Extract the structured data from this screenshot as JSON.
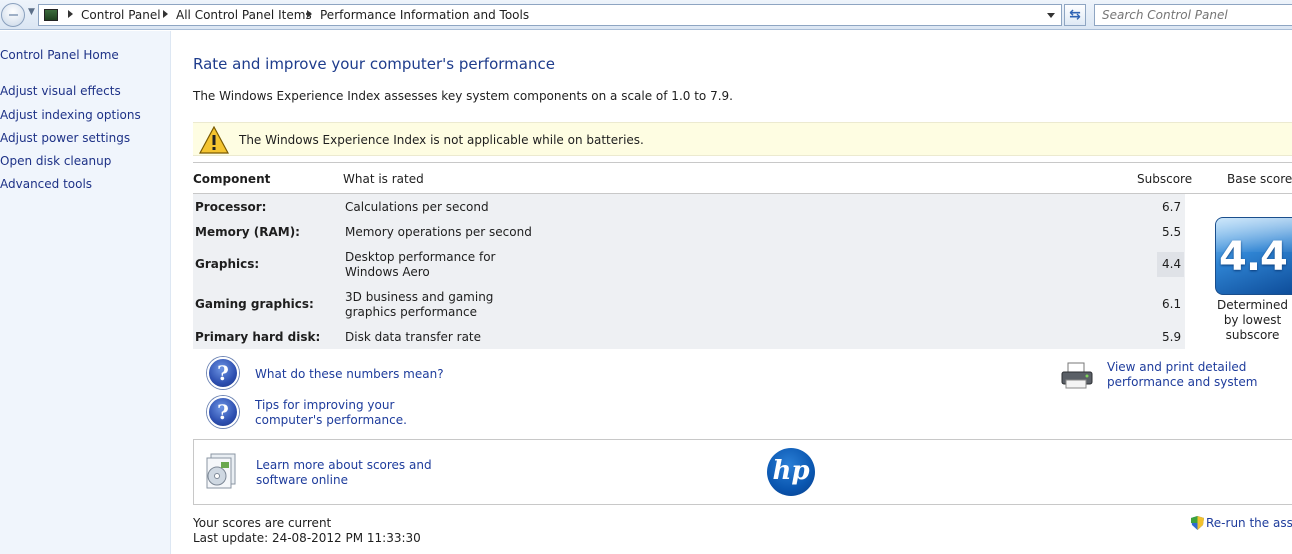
{
  "address": {
    "crumbs": [
      "Control Panel",
      "All Control Panel Items",
      "Performance Information and Tools"
    ],
    "search_placeholder": "Search Control Panel"
  },
  "sidebar": {
    "home": "Control Panel Home",
    "links": [
      "Adjust visual effects",
      "Adjust indexing options",
      "Adjust power settings",
      "Open disk cleanup",
      "Advanced tools"
    ]
  },
  "main": {
    "title": "Rate and improve your computer's performance",
    "description": "The Windows Experience Index assesses key system components on a scale of 1.0 to 7.9.",
    "warning": "The Windows Experience Index is not applicable while on batteries.",
    "columns": {
      "component": "Component",
      "what": "What is rated",
      "subscore": "Subscore",
      "base": "Base score"
    },
    "rows": [
      {
        "component": "Processor:",
        "what": "Calculations per second",
        "score": "6.7"
      },
      {
        "component": "Memory (RAM):",
        "what": "Memory operations per second",
        "score": "5.5"
      },
      {
        "component": "Graphics:",
        "what": "Desktop performance for Windows Aero",
        "score": "4.4"
      },
      {
        "component": "Gaming graphics:",
        "what": "3D business and gaming graphics performance",
        "score": "6.1"
      },
      {
        "component": "Primary hard disk:",
        "what": "Disk data transfer rate",
        "score": "5.9"
      }
    ],
    "base_score": "4.4",
    "base_note": "Determined by lowest subscore",
    "help_links": [
      "What do these numbers mean?",
      "Tips for improving your computer's performance."
    ],
    "print_link": "View and print detailed performance and system information",
    "learn_link": "Learn more about scores and software online",
    "hp_logo": "hp",
    "status": "Your scores are current",
    "last_update": "Last update: 24-08-2012 PM 11:33:30",
    "rerun": "Re-run the assessment"
  },
  "colors": {
    "link": "#1e3c9c",
    "title": "#1e3c8c",
    "warning_bg": "#fefde2",
    "badge": "#2f84d3"
  }
}
